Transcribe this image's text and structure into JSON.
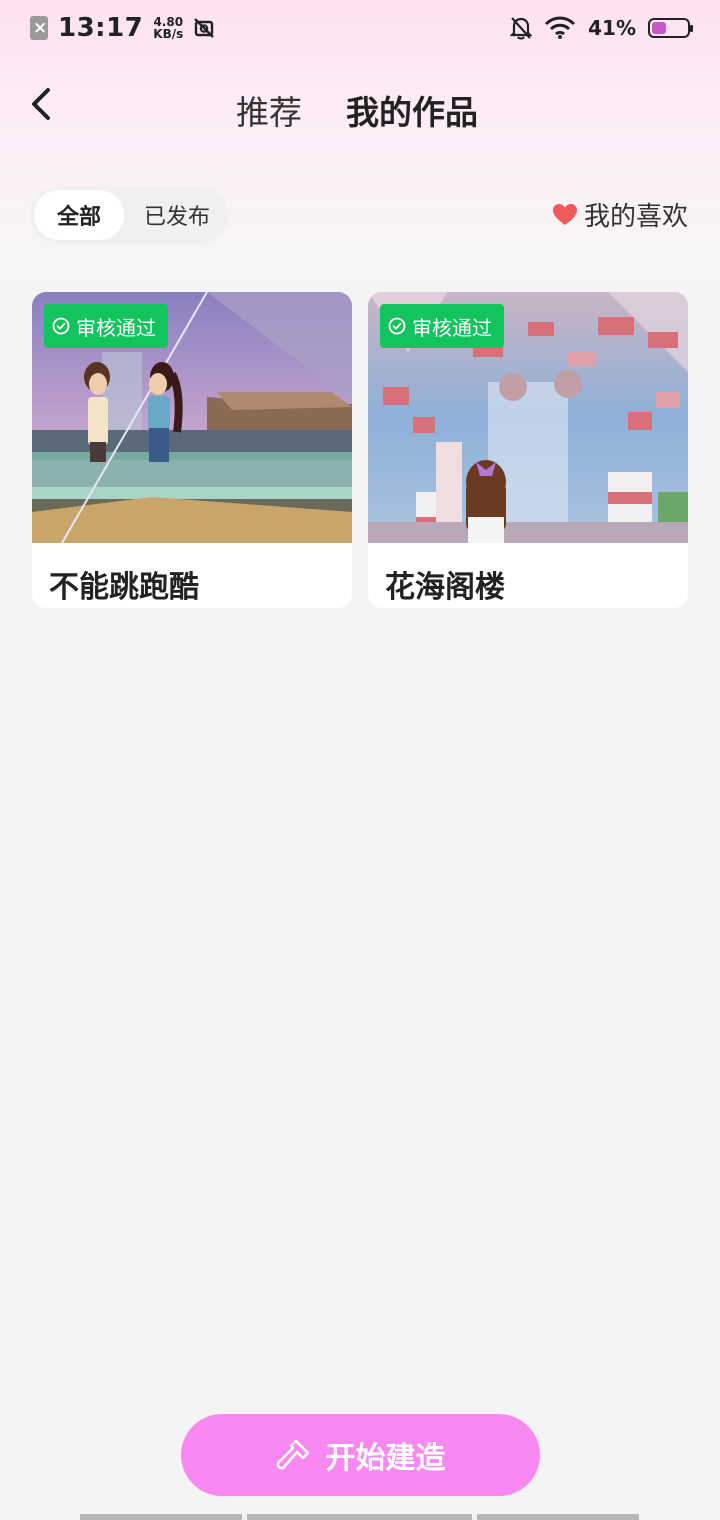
{
  "status_bar": {
    "time": "13:17",
    "net_speed_value": "4.80",
    "net_speed_unit": "KB/s",
    "battery_percent": "41%",
    "battery_level": 0.41
  },
  "header": {
    "tab_recommend": "推荐",
    "tab_my_works": "我的作品"
  },
  "filter": {
    "all_label": "全部",
    "published_label": "已发布",
    "favorites_label": "我的喜欢"
  },
  "works": [
    {
      "title": "不能跳跑酷",
      "status": "审核通过"
    },
    {
      "title": "花海阁楼",
      "status": "审核通过"
    }
  ],
  "bottom": {
    "start_build_label": "开始建造"
  },
  "colors": {
    "accent_pink": "#f888f2",
    "approved_green": "#13c45c",
    "heart_red": "#f05a5a"
  }
}
